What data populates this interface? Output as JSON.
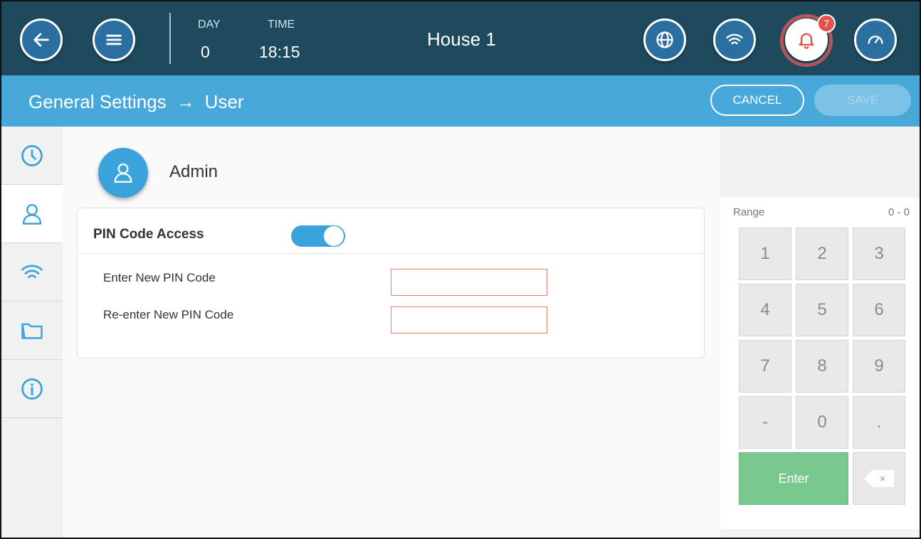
{
  "topbar": {
    "day_label": "DAY",
    "day_value": "0",
    "time_label": "TIME",
    "time_value": "18:15",
    "title": "House 1",
    "alarm_count": "7",
    "icons": [
      "back-arrow-icon",
      "menu-icon",
      "globe-icon",
      "wifi-icon",
      "bell-icon",
      "gauge-icon"
    ]
  },
  "subbar": {
    "breadcrumb_parent": "General Settings",
    "breadcrumb_separator": "→",
    "breadcrumb_current": "User",
    "cancel_label": "CANCEL",
    "save_label": "SAVE"
  },
  "sidebar": {
    "items": [
      {
        "icon": "clock-icon",
        "active": false
      },
      {
        "icon": "user-icon",
        "active": true
      },
      {
        "icon": "wifi-icon",
        "active": false
      },
      {
        "icon": "folder-icon",
        "active": false
      },
      {
        "icon": "info-icon",
        "active": false
      }
    ]
  },
  "user": {
    "name": "Admin"
  },
  "pin": {
    "title": "PIN Code Access",
    "enabled": true,
    "new_label": "Enter New PIN Code",
    "new_value": "",
    "reenter_label": "Re-enter New PIN Code",
    "reenter_value": ""
  },
  "keypad": {
    "range_label": "Range",
    "range_value": "0 - 0",
    "keys": [
      "1",
      "2",
      "3",
      "4",
      "5",
      "6",
      "7",
      "8",
      "9",
      "-",
      "0",
      "."
    ],
    "enter_label": "Enter",
    "backspace_symbol": "×"
  },
  "colors": {
    "topbar": "#1f4a5e",
    "subbar": "#49a8da",
    "accent": "#3aa3dc",
    "enter": "#79c890",
    "badge": "#e2514c"
  }
}
